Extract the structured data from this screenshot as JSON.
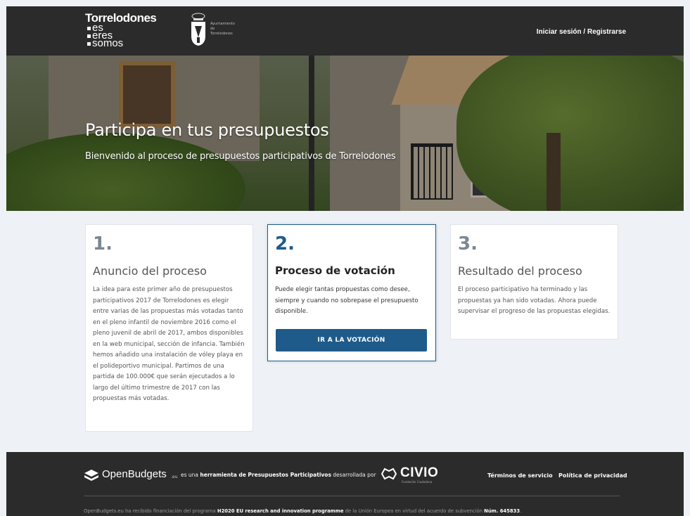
{
  "header": {
    "logo_lines": [
      "Torrelodones",
      "es",
      "eres",
      "somos"
    ],
    "crest_text": [
      "Ayuntamiento",
      "de",
      "Torrelodones"
    ],
    "login_label": "Iniciar sesión / Registrarse"
  },
  "hero": {
    "title": "Participa en tus presupuestos",
    "subtitle": "Bienvenido al proceso de presupuestos participativos de Torrelodones"
  },
  "steps": [
    {
      "number": "1.",
      "title": "Anuncio del proceso",
      "text": "La idea para este primer año de presupuestos participativos 2017 de Torrelodones es elegir entre varias de las propuestas más votadas tanto en el pleno infantil de noviembre 2016 como el pleno juvenil de abril de 2017, ambos disponibles en la web municipal, sección de infancia. También hemos añadido una instalación de vóley playa en el polideportivo municipal. Partimos de una partida de 100.000€ que serán ejecutados a lo largo del último trimestre de 2017 con las propuestas más votadas."
    },
    {
      "number": "2.",
      "title": "Proceso de votación",
      "text": "Puede elegir tantas propuestas como desee, siempre y cuando no sobrepase el presupuesto disponible.",
      "button_label": "IR A LA VOTACIÓN"
    },
    {
      "number": "3.",
      "title": "Resultado del proceso",
      "text": "El proceso participativo ha terminado y las propuestas ya han sido votadas. Ahora puede supervisar el progreso de las propuestas elegidas."
    }
  ],
  "footer": {
    "brand": "OpenBudgets",
    "brand_suffix": ".eu",
    "desc_pre": "es una ",
    "desc_bold": "herramienta de Presupuestos Participativos",
    "desc_post": " desarrollada por",
    "partner": "CIVIO",
    "partner_sub": "Fundación Ciudadana",
    "terms_label": "Términos de servicio",
    "privacy_label": "Política de privacidad",
    "funding_pre": "OpenBudgets.eu ha recibido financiación del programa ",
    "funding_bold1": "H2020 EU research and innovation programme",
    "funding_mid": " de la Unión Europea en virtud del acuerdo de subvención ",
    "funding_bold2": "Núm. 645833",
    "funding_end": "."
  },
  "colors": {
    "header_bg": "#2b2b2b",
    "accent": "#1e5b8a",
    "page_bg": "#eef2f6"
  },
  "icons": [
    "crest-icon",
    "openbudgets-logo-icon",
    "civio-logo-icon"
  ]
}
